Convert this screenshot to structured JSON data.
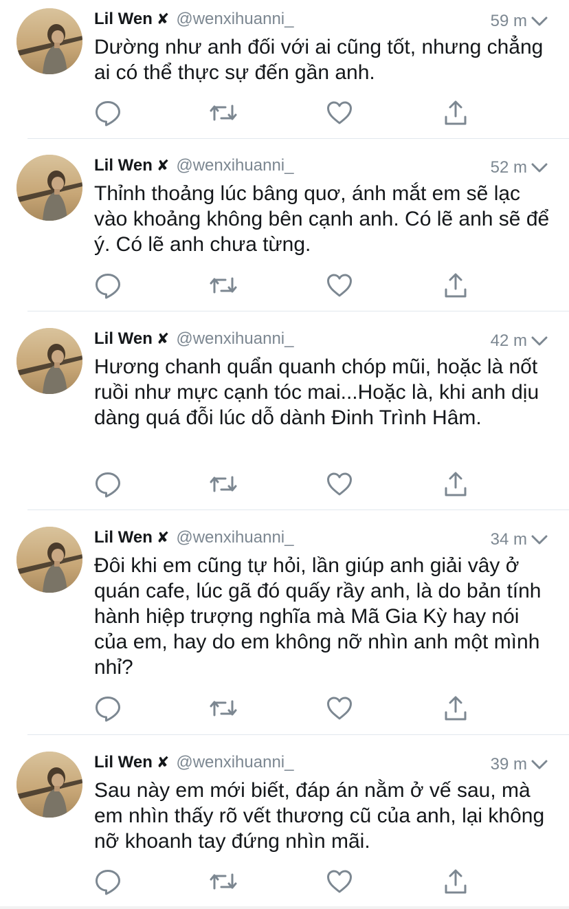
{
  "author": {
    "name": "Lil Wen",
    "badge": "✘",
    "handle": "@wenxihuanni_"
  },
  "colors": {
    "text": "#14171a",
    "secondary": "#7c8791",
    "icon": "#7c8791",
    "divider": "#e1e8ed"
  },
  "icons": [
    "reply-icon",
    "retweet-icon",
    "like-icon",
    "share-icon",
    "chevron-down-icon"
  ],
  "tweets": [
    {
      "time": "59 m",
      "text": "Dường như anh đối với ai cũng tốt, nhưng chẳng ai có thể thực sự đến gần anh."
    },
    {
      "time": "52 m",
      "text": "Thỉnh thoảng lúc bâng quơ, ánh mắt em sẽ lạc vào khoảng không bên cạnh anh. Có lẽ anh sẽ để ý. Có lẽ anh chưa từng."
    },
    {
      "time": "42 m",
      "text": "Hương chanh quẩn quanh chóp mũi, hoặc là nốt ruồi như mực cạnh tóc mai...Hoặc là, khi anh dịu dàng quá đỗi lúc dỗ dành Đinh Trình Hâm."
    },
    {
      "time": "34 m",
      "text": "Đôi khi em cũng tự hỏi, lần giúp anh giải vây ở quán cafe, lúc gã đó quấy rầy anh, là do bản tính hành hiệp trượng nghĩa mà Mã Gia Kỳ hay nói của em, hay do em không nỡ nhìn anh một mình nhỉ?"
    },
    {
      "time": "39 m",
      "text": "Sau này em mới biết, đáp án nằm ở vế sau, mà em nhìn thấy rõ vết thương cũ của anh, lại không nỡ khoanh tay đứng nhìn mãi."
    }
  ]
}
